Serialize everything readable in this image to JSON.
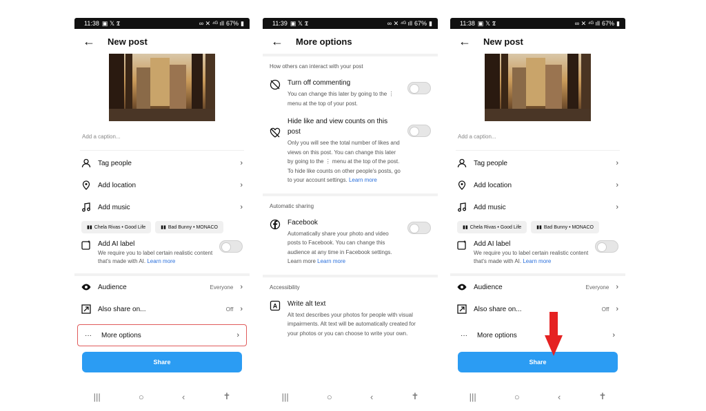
{
  "status": {
    "time1": "11:38",
    "time2": "11:39",
    "time3": "11:38",
    "battery": "67%"
  },
  "screen1": {
    "title": "New post",
    "caption_placeholder": "Add a caption...",
    "tag_people": "Tag people",
    "add_location": "Add location",
    "add_music": "Add music",
    "chip1": "Chela Rivas • Good Life",
    "chip2": "Bad Bunny • MONACO",
    "ai_label": "Add AI label",
    "ai_desc": "We require you to label certain realistic content that's made with AI.",
    "learn_more": "Learn more",
    "audience": "Audience",
    "audience_value": "Everyone",
    "also_share": "Also share on...",
    "also_share_value": "Off",
    "more_options": "More options",
    "share": "Share"
  },
  "screen2": {
    "title": "More options",
    "section_interact": "How others can interact with your post",
    "turn_off_commenting": "Turn off commenting",
    "turn_off_commenting_desc": "You can change this later by going to the ⋮ menu at the top of your post.",
    "hide_counts": "Hide like and view counts on this post",
    "hide_counts_desc": "Only you will see the total number of likes and views on this post. You can change this later by going to the ⋮ menu at the top of the post. To hide like counts on other people's posts, go to your account settings.",
    "learn_more": "Learn more",
    "section_sharing": "Automatic sharing",
    "facebook": "Facebook",
    "facebook_desc": "Automatically share your photo and video posts to Facebook. You can change this audience at any time in Facebook settings. Learn more",
    "facebook_link": "Learn more",
    "section_accessibility": "Accessibility",
    "alt_text": "Write alt text",
    "alt_text_desc": "Alt text describes your photos for people with visual impairments. Alt text will be automatically created for your photos or you can choose to write your own."
  },
  "icons": [
    "back-arrow-icon",
    "person-icon",
    "location-pin-icon",
    "music-note-icon",
    "ai-label-icon",
    "eye-icon",
    "share-arrow-icon",
    "more-dots-icon",
    "chevron-right-icon",
    "comment-off-icon",
    "heart-off-icon",
    "facebook-icon",
    "alt-text-icon",
    "recent-apps-icon",
    "home-icon",
    "back-nav-icon",
    "accessibility-icon",
    "down-arrow-icon"
  ],
  "colors": {
    "accent": "#2b9cf3",
    "highlight": "#e05a5a",
    "arrow": "#e52222",
    "link": "#2a6fdb"
  }
}
